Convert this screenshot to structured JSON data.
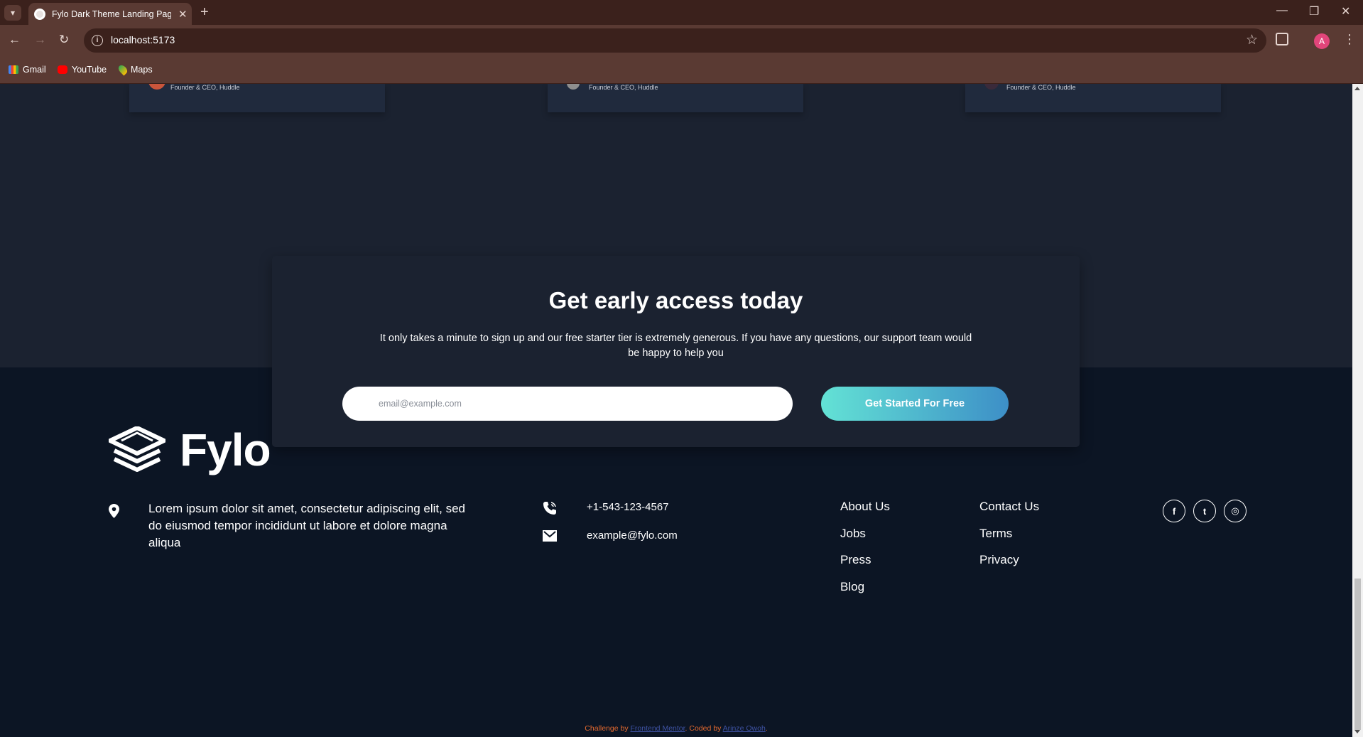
{
  "browser": {
    "tab_title": "Fylo Dark Theme Landing Page",
    "url": "localhost:5173",
    "profile_initial": "A",
    "bookmarks": [
      {
        "label": "Gmail"
      },
      {
        "label": "YouTube"
      },
      {
        "label": "Maps"
      }
    ]
  },
  "testimonials": [
    {
      "role": "Founder & CEO, Huddle"
    },
    {
      "role": "Founder & CEO, Huddle"
    },
    {
      "role": "Founder & CEO, Huddle"
    }
  ],
  "cta": {
    "title": "Get early access today",
    "text": "It only takes a minute to sign up and our free starter tier is extremely generous. If you have any questions, our support team would be happy to help you",
    "email_placeholder": "email@example.com",
    "button_label": "Get Started For Free"
  },
  "footer": {
    "logo_text": "Fylo",
    "address": "Lorem ipsum dolor sit amet, consectetur adipiscing elit, sed do eiusmod tempor incididunt ut labore et dolore magna aliqua",
    "phone": "+1-543-123-4567",
    "email": "example@fylo.com",
    "links_col1": [
      "About Us",
      "Jobs",
      "Press",
      "Blog"
    ],
    "links_col2": [
      "Contact Us",
      "Terms",
      "Privacy"
    ],
    "social": [
      {
        "icon": "facebook-icon",
        "glyph": "f"
      },
      {
        "icon": "twitter-icon",
        "glyph": "t"
      },
      {
        "icon": "instagram-icon",
        "glyph": "◎"
      }
    ],
    "attribution": {
      "prefix": "Challenge by ",
      "link1": "Frontend Mentor",
      "middle": ". Coded by ",
      "link2": "Arinze Owoh",
      "suffix": "."
    }
  },
  "colors": {
    "section_top_bg": "#1b2230",
    "footer_bg": "#0c1524",
    "gradient_start": "#63e2d5",
    "gradient_end": "#3d8fc7",
    "attribution_text": "#e4692f"
  }
}
